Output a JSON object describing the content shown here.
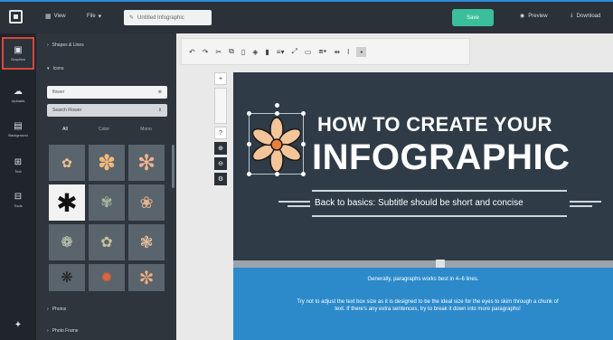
{
  "topbar": {
    "view_label": "View",
    "file_label": "File",
    "doc_title": "Untitled Infographic",
    "save_label": "Save",
    "preview_label": "Preview",
    "download_label": "Download",
    "accent_color": "#3bbf9b"
  },
  "rail": {
    "items": [
      {
        "label": "Graphics",
        "icon": "graphics-icon",
        "active": true
      },
      {
        "label": "Uploads",
        "icon": "uploads-icon"
      },
      {
        "label": "Background",
        "icon": "background-icon"
      },
      {
        "label": "Text",
        "icon": "text-icon"
      },
      {
        "label": "Tools",
        "icon": "tools-icon"
      }
    ]
  },
  "panel": {
    "sections": {
      "shapes": "Shapes & Lines",
      "icons": "Icons",
      "photos": "Photos",
      "photo_frame": "Photo Frame"
    },
    "search_value": "flower",
    "filter_value": "Search Flower",
    "filter_tabs": [
      "All",
      "Color",
      "Mono"
    ]
  },
  "canvas": {
    "title_line1": "HOW TO CREATE YOUR",
    "title_line2": "INFOGRAPHIC",
    "subtitle": "Back to basics: Subtitle should be short and concise",
    "paragraph1": "Generally, paragraphs works best in 4–6 lines.",
    "paragraph2": "Try not to adjust the text box size as it is designed to be the ideal size for the eyes to skim through a chunk of text. If there's any extra sentences, try to break it down into more paragraphs!",
    "bg_color": "#2f3b47",
    "section_color": "#2c8acb"
  }
}
